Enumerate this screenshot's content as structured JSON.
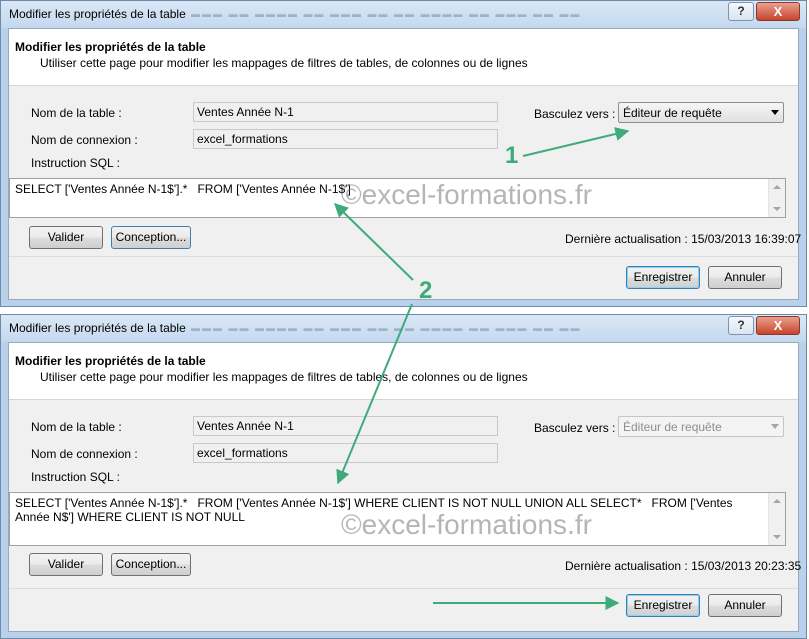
{
  "dialogs": [
    {
      "title": "Modifier les propriétés de la table",
      "header_title": "Modifier les propriétés de la table",
      "header_subtitle": "Utiliser cette page pour modifier les mappages de filtres de tables, de colonnes ou de lignes",
      "table_name_label": "Nom de la table :",
      "table_name_value": "Ventes Année N-1",
      "connection_label": "Nom de connexion :",
      "connection_value": "excel_formations",
      "sql_label": "Instruction SQL :",
      "switch_label": "Basculez vers :",
      "switch_value": "Éditeur de requête",
      "sql_text": "SELECT ['Ventes Année N-1$'].*   FROM ['Ventes Année N-1$']",
      "validate_label": "Valider",
      "design_label": "Conception...",
      "last_update": "Dernière actualisation : 15/03/2013 16:39:07",
      "save_label": "Enregistrer",
      "cancel_label": "Annuler",
      "help_label": "?",
      "close_label": "X",
      "watermark": "©excel-formations.fr"
    },
    {
      "title": "Modifier les propriétés de la table",
      "header_title": "Modifier les propriétés de la table",
      "header_subtitle": "Utiliser cette page pour modifier les mappages de filtres de tables, de colonnes ou de lignes",
      "table_name_label": "Nom de la table :",
      "table_name_value": "Ventes Année N-1",
      "connection_label": "Nom de connexion :",
      "connection_value": "excel_formations",
      "sql_label": "Instruction SQL :",
      "switch_label": "Basculez vers :",
      "switch_value": "Éditeur de requête",
      "sql_text": "SELECT ['Ventes Année N-1$'].*   FROM ['Ventes Année N-1$'] WHERE CLIENT IS NOT NULL UNION ALL SELECT*   FROM ['Ventes Année N$'] WHERE CLIENT IS NOT NULL",
      "validate_label": "Valider",
      "design_label": "Conception...",
      "last_update": "Dernière actualisation : 15/03/2013 20:23:35",
      "save_label": "Enregistrer",
      "cancel_label": "Annuler",
      "help_label": "?",
      "close_label": "X",
      "watermark": "©excel-formations.fr"
    }
  ],
  "annotations": {
    "marker_1": "1",
    "marker_2": "2",
    "arrow_color": "#3dab7a"
  },
  "colors": {
    "window_frame": "#b9d1ea",
    "dialog_body": "#f0f0f0",
    "close_button": "#c8442b",
    "default_button_border": "#3c7fb1"
  }
}
